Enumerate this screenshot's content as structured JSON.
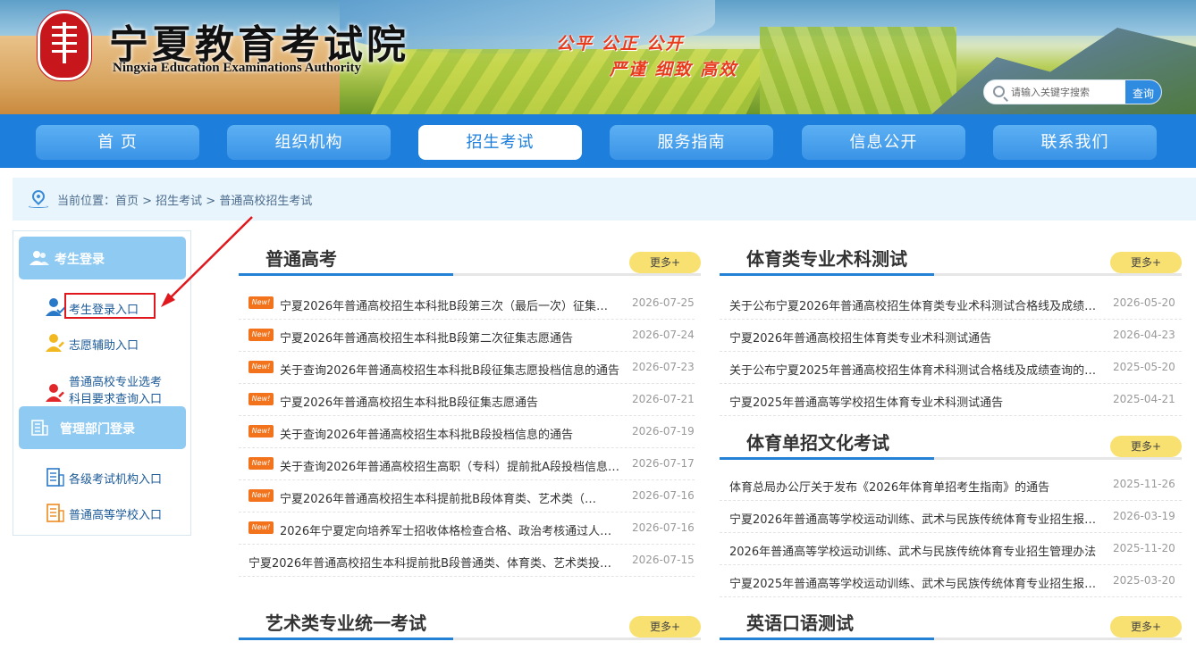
{
  "header": {
    "site_name": "宁夏教育考试院",
    "site_name_en": "Ningxia Education Examinations Authority",
    "slogan_line1": "公平 公正 公开",
    "slogan_line2": "严谨 细致 高效",
    "search_placeholder": "请输入关键字搜索",
    "search_button": "查询"
  },
  "nav": {
    "items": [
      "首 页",
      "组织机构",
      "招生考试",
      "服务指南",
      "信息公开",
      "联系我们"
    ],
    "active_index": 2
  },
  "breadcrumb": {
    "text": "当前位置：首页 > 招生考试 > 普通高校招生考试"
  },
  "sidebar": {
    "student_login_title": "考生登录",
    "student_links": [
      "考生登录入口",
      "志愿辅助入口",
      "普通高校专业选考",
      "科目要求查询入口"
    ],
    "admin_login_title": "管理部门登录",
    "admin_links": [
      "各级考试机构入口",
      "普通高等学校入口"
    ]
  },
  "sections": {
    "more_label": "更多+",
    "new_label": "New!",
    "gaokao": {
      "title": "普通高考",
      "items": [
        {
          "title": "宁夏2026年普通高校招生本科批B段第三次（最后一次）征集志愿通告",
          "date": "2026-07-25",
          "is_new": true
        },
        {
          "title": "宁夏2026年普通高校招生本科批B段第二次征集志愿通告",
          "date": "2026-07-24",
          "is_new": true
        },
        {
          "title": "关于查询2026年普通高校招生本科批B段征集志愿投档信息的通告",
          "date": "2026-07-23",
          "is_new": true
        },
        {
          "title": "宁夏2026年普通高校招生本科批B段征集志愿通告",
          "date": "2026-07-21",
          "is_new": true
        },
        {
          "title": "关于查询2026年普通高校招生本科批B段投档信息的通告",
          "date": "2026-07-19",
          "is_new": true
        },
        {
          "title": "关于查询2026年普通高校招生高职（专科）提前批A段投档信息的通告",
          "date": "2026-07-17",
          "is_new": true
        },
        {
          "title": "宁夏2026年普通高校招生本科提前批B段体育类、艺术类（…",
          "date": "2026-07-16",
          "is_new": true
        },
        {
          "title": "2026年宁夏定向培养军士招收体格检查合格、政治考核通过人员名单",
          "date": "2026-07-16",
          "is_new": true
        },
        {
          "title": "宁夏2026年普通高校招生本科提前批B段普通类、体育类、艺术类投档信息",
          "date": "2026-07-15",
          "is_new": false
        }
      ]
    },
    "sports_test": {
      "title": "体育类专业术科测试",
      "items": [
        {
          "title": "关于公布宁夏2026年普通高校招生体育类专业术科测试合格线及成绩查询的通告",
          "date": "2026-05-20"
        },
        {
          "title": "宁夏2026年普通高校招生体育类专业术科测试通告",
          "date": "2026-04-23"
        },
        {
          "title": "关于公布宁夏2025年普通高校招生体育术科测试合格线及成绩查询的通告",
          "date": "2025-05-20"
        },
        {
          "title": "宁夏2025年普通高等学校招生体育专业术科测试通告",
          "date": "2025-04-21"
        }
      ]
    },
    "sports_single": {
      "title": "体育单招文化考试",
      "items": [
        {
          "title": "体育总局办公厅关于发布《2026年体育单招考生指南》的通告",
          "date": "2025-11-26"
        },
        {
          "title": "宁夏2026年普通高等学校运动训练、武术与民族传统体育专业招生报名通告",
          "date": "2026-03-19"
        },
        {
          "title": "2026年普通高等学校运动训练、武术与民族传统体育专业招生管理办法",
          "date": "2025-11-20"
        },
        {
          "title": "宁夏2025年普通高等学校运动训练、武术与民族传统体育专业招生报名通告",
          "date": "2025-03-20"
        }
      ]
    },
    "art": {
      "title": "艺术类专业统一考试"
    },
    "english": {
      "title": "英语口语测试"
    }
  },
  "colors": {
    "nav_bg": "#1d7fdb",
    "accent": "#2482d6",
    "more_btn": "#f8e171",
    "new_tag": "#f2731c",
    "highlight": "#e0171c"
  },
  "icons": {
    "search": "search-icon",
    "location": "location-pin-icon",
    "users": "users-icon",
    "building": "building-icon"
  }
}
